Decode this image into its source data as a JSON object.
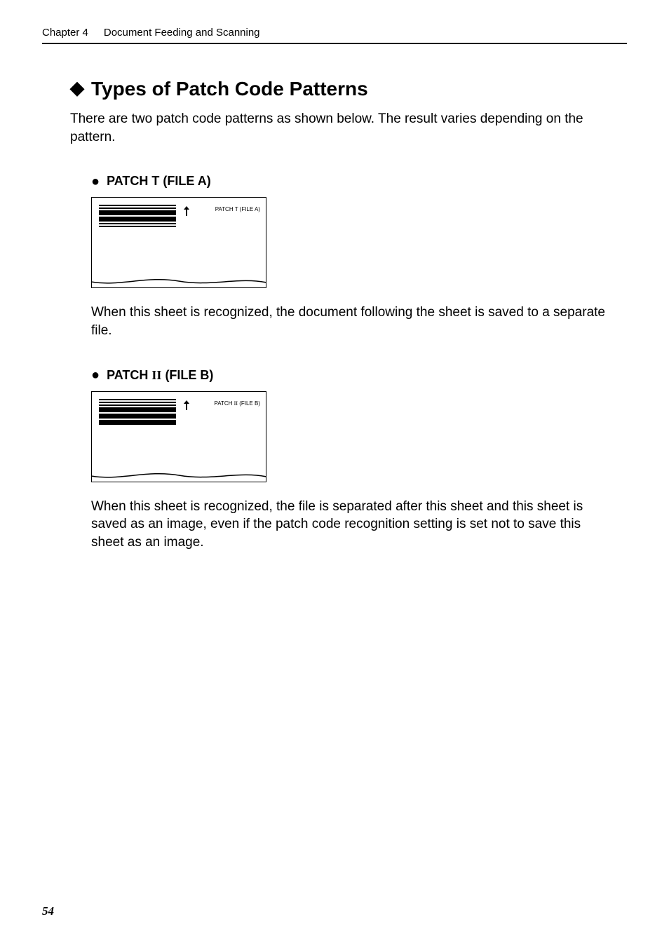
{
  "header": {
    "chapter": "Chapter 4",
    "title": "Document Feeding and Scanning"
  },
  "section": {
    "title": "Types of Patch Code Patterns",
    "intro": "There are two patch code patterns as shown below. The result varies depending on the pattern."
  },
  "patch_t": {
    "heading_prefix": "PATCH T (FILE A)",
    "figure_label": "PATCH T (FILE A)",
    "description": "When this sheet is recognized, the document following the sheet is saved to a separate file."
  },
  "patch_ii": {
    "heading_prefix": "PATCH ",
    "heading_roman": "II",
    "heading_suffix": " (FILE B)",
    "figure_label_prefix": "PATCH ",
    "figure_label_roman": "II",
    "figure_label_suffix": " (FILE B)",
    "description": "When this sheet is recognized, the file is separated after this sheet and this sheet is saved as an image, even if the patch code recognition setting is set not to save this sheet as an image."
  },
  "page_number": "54"
}
